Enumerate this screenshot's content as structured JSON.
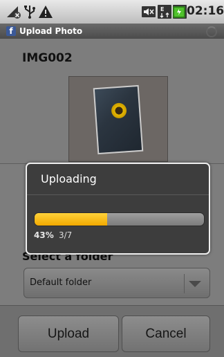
{
  "status_bar": {
    "time": "02:16",
    "icons": [
      "mobile-no-signal-icon",
      "usb-icon",
      "warning-icon",
      "mute-icon",
      "data-transfer-icon",
      "signal-bars-icon",
      "battery-charging-icon"
    ]
  },
  "app_bar": {
    "title": "Upload Photo",
    "logo": "f"
  },
  "photo": {
    "filename": "IMG002"
  },
  "folder": {
    "label": "Select a folder",
    "value": "Default folder"
  },
  "buttons": {
    "upload": "Upload",
    "cancel": "Cancel"
  },
  "dialog": {
    "title": "Uploading",
    "progress": 0.43,
    "percent_text": "43%",
    "count_text": "3/7",
    "progress_color": "#f5b800"
  }
}
